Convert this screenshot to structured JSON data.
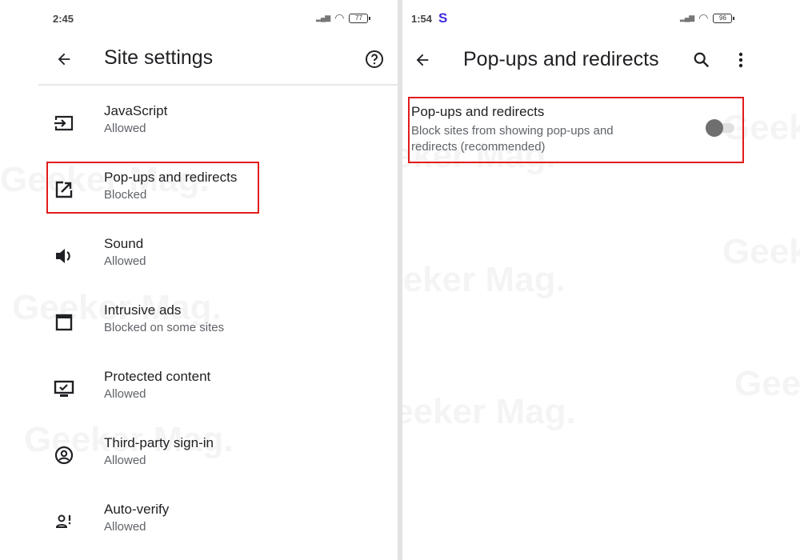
{
  "watermark": "Geeker Mag.",
  "left": {
    "status": {
      "time": "2:45",
      "battery": "77"
    },
    "title": "Site settings",
    "items": [
      {
        "title": "JavaScript",
        "subtitle": "Allowed",
        "icon": "javascript-icon"
      },
      {
        "title": "Pop-ups and redirects",
        "subtitle": "Blocked",
        "icon": "open-in-new-icon"
      },
      {
        "title": "Sound",
        "subtitle": "Allowed",
        "icon": "volume-icon"
      },
      {
        "title": "Intrusive ads",
        "subtitle": "Blocked on some sites",
        "icon": "window-icon"
      },
      {
        "title": "Protected content",
        "subtitle": "Allowed",
        "icon": "monitor-check-icon"
      },
      {
        "title": "Third-party sign-in",
        "subtitle": "Allowed",
        "icon": "account-circle-icon"
      },
      {
        "title": "Auto-verify",
        "subtitle": "Allowed",
        "icon": "person-alert-icon"
      }
    ]
  },
  "right": {
    "status": {
      "time": "1:54",
      "app_badge": "S",
      "battery": "96"
    },
    "title": "Pop-ups and redirects",
    "setting": {
      "title": "Pop-ups and redirects",
      "description": "Block sites from showing pop-ups and redirects (recommended)",
      "enabled": false
    },
    "colors": {
      "highlight": "#e21b1b",
      "badge": "#3d2ce0"
    }
  }
}
